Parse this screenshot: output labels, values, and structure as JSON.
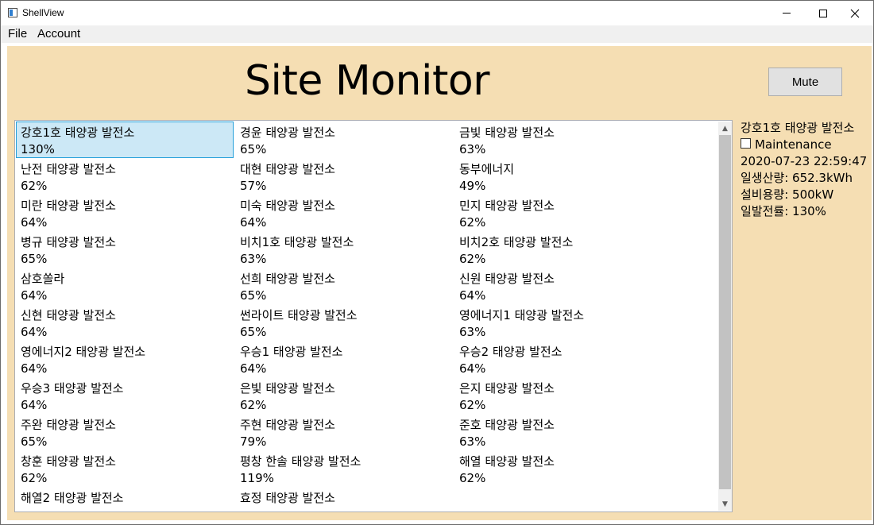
{
  "window": {
    "title": "ShellView",
    "controls": {
      "minimize": "minimize-icon",
      "maximize": "maximize-icon",
      "close": "close-icon"
    }
  },
  "menu": {
    "items": [
      "File",
      "Account"
    ]
  },
  "header": {
    "title": "Site Monitor",
    "mute_label": "Mute"
  },
  "sites": [
    {
      "name": "강호1호 태양광 발전소",
      "percent": "130%",
      "selected": true
    },
    {
      "name": "경윤 태양광 발전소",
      "percent": "65%"
    },
    {
      "name": "금빛 태양광 발전소",
      "percent": "63%"
    },
    {
      "name": "난전 태양광 발전소",
      "percent": "62%"
    },
    {
      "name": "대현 태양광 발전소",
      "percent": "57%"
    },
    {
      "name": "동부에너지",
      "percent": "49%"
    },
    {
      "name": "미란 태양광 발전소",
      "percent": "64%"
    },
    {
      "name": "미숙 태양광 발전소",
      "percent": "64%"
    },
    {
      "name": "민지 태양광 발전소",
      "percent": "62%"
    },
    {
      "name": "병규 태양광 발전소",
      "percent": "65%"
    },
    {
      "name": "비치1호 태양광 발전소",
      "percent": "63%"
    },
    {
      "name": "비치2호 태양광 발전소",
      "percent": "62%"
    },
    {
      "name": "삼호쏠라",
      "percent": "64%"
    },
    {
      "name": "선희 태양광 발전소",
      "percent": "65%"
    },
    {
      "name": "신원 태양광 발전소",
      "percent": "64%"
    },
    {
      "name": "신현 태양광 발전소",
      "percent": "64%"
    },
    {
      "name": "썬라이트 태양광 발전소",
      "percent": "65%"
    },
    {
      "name": "영에너지1 태양광 발전소",
      "percent": "63%"
    },
    {
      "name": "영에너지2 태양광 발전소",
      "percent": "64%"
    },
    {
      "name": "우승1 태양광 발전소",
      "percent": "64%"
    },
    {
      "name": "우승2 태양광 발전소",
      "percent": "64%"
    },
    {
      "name": "우승3 태양광 발전소",
      "percent": "64%"
    },
    {
      "name": "은빛 태양광 발전소",
      "percent": "62%"
    },
    {
      "name": "은지 태양광 발전소",
      "percent": "62%"
    },
    {
      "name": "주완 태양광 발전소",
      "percent": "65%"
    },
    {
      "name": "주현 태양광 발전소",
      "percent": "79%"
    },
    {
      "name": "준호 태양광 발전소",
      "percent": "63%"
    },
    {
      "name": "창훈 태양광 발전소",
      "percent": "62%"
    },
    {
      "name": "평창 한솔 태양광 발전소",
      "percent": "119%"
    },
    {
      "name": "해열 태양광 발전소",
      "percent": "62%"
    },
    {
      "name": "해열2 태양광 발전소",
      "percent": ""
    },
    {
      "name": "효정 태양광 발전소",
      "percent": ""
    }
  ],
  "scrollbar": {
    "up_icon": "▲",
    "down_icon": "▼"
  },
  "detail": {
    "site_name": "강호1호 태양광 발전소",
    "maintenance_label": "Maintenance",
    "maintenance_checked": false,
    "timestamp": "2020-07-23 22:59:47",
    "daily_generation": "일생산량: 652.3kWh",
    "capacity": "설비용량: 500kW",
    "daily_rate": "일발전률: 130%"
  },
  "colors": {
    "content_background": "#f5deb3",
    "selection_background": "#cce8f6",
    "selection_border": "#26a0da"
  }
}
